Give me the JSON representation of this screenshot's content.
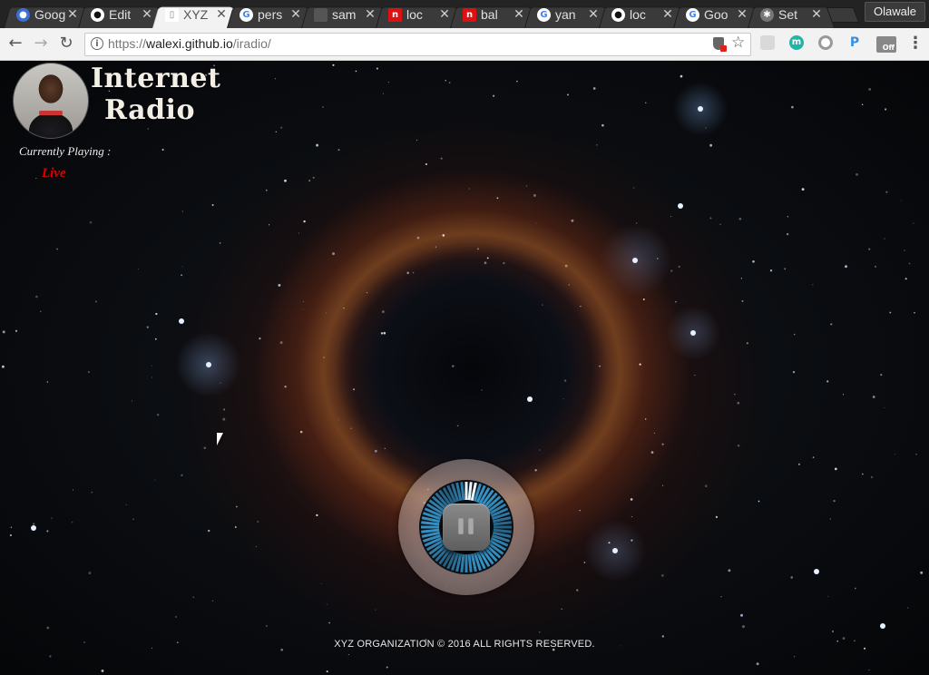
{
  "browser": {
    "tabs": [
      {
        "title": "Goog",
        "icon": "person-icon"
      },
      {
        "title": "Edit",
        "icon": "github-icon"
      },
      {
        "title": "XYZ",
        "icon": "document-icon",
        "active": true
      },
      {
        "title": "pers",
        "icon": "google-icon"
      },
      {
        "title": "sam",
        "icon": "blank-icon"
      },
      {
        "title": "loc",
        "icon": "red-n-icon"
      },
      {
        "title": "bal",
        "icon": "red-n-icon"
      },
      {
        "title": "yan",
        "icon": "google-icon"
      },
      {
        "title": "loc",
        "icon": "github-icon"
      },
      {
        "title": "Goo",
        "icon": "google-icon"
      },
      {
        "title": "Set",
        "icon": "gear-icon"
      }
    ],
    "profile_name": "Olawale",
    "url_scheme": "https://",
    "url_host": "walexi.github.io",
    "url_path": "/iradio/",
    "extension_badge": "Off"
  },
  "page": {
    "title": "Internet Radio",
    "currently_playing_label": "Currently Playing :",
    "currently_playing_value": "Live",
    "footer": "XYZ ORGANIZATION © 2016 ALL RIGHTS RESERVED.",
    "player": {
      "state": "playing",
      "progress": 0.05
    }
  },
  "colors": {
    "title_text": "#f3efe6",
    "live_text": "#e00000",
    "dial_accent": "#3aa0d8"
  }
}
